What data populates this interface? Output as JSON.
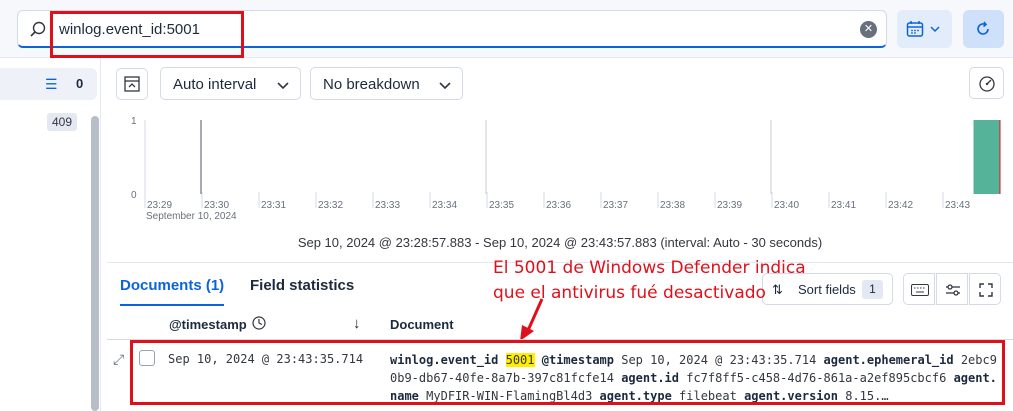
{
  "query": {
    "text": "winlog.event_id:5001"
  },
  "sidebar": {
    "filter_count": "0",
    "field_count": "409"
  },
  "chart_toolbar": {
    "interval_label": "Auto interval",
    "breakdown_label": "No breakdown"
  },
  "chart_data": {
    "type": "bar",
    "y_ticks": [
      "1",
      "0"
    ],
    "x_tick_labels": [
      "23:29",
      "23:30",
      "23:31",
      "23:32",
      "23:33",
      "23:34",
      "23:35",
      "23:36",
      "23:37",
      "23:38",
      "23:39",
      "23:40",
      "23:41",
      "23:42",
      "23:43"
    ],
    "x_sublabel": "September 10, 2024",
    "values": [
      0,
      0,
      0,
      0,
      0,
      0,
      0,
      0,
      0,
      0,
      0,
      0,
      0,
      0,
      0,
      0,
      0,
      0,
      0,
      0,
      0,
      0,
      0,
      0,
      0,
      0,
      0,
      0,
      0,
      1
    ],
    "ylim": [
      0,
      1
    ],
    "bar_color": "#54b399",
    "time_range": "Sep 10, 2024 @ 23:28:57.883 - Sep 10, 2024 @ 23:43:57.883 (interval: Auto - 30 seconds)"
  },
  "tabs": {
    "documents": "Documents (1)",
    "field_statistics": "Field statistics"
  },
  "sort": {
    "label": "Sort fields",
    "count": "1"
  },
  "annotation": {
    "line1": "El 5001 de Windows Defender indica",
    "line2": "que el antivirus fué desactivado"
  },
  "grid": {
    "col_timestamp": "@timestamp",
    "col_document": "Document",
    "row": {
      "timestamp": "Sep 10, 2024 @ 23:43:35.714",
      "k1": "winlog.event_id",
      "v1": "5001",
      "k2": "@timestamp",
      "v2": "Sep 10, 2024 @ 23:43:35.714",
      "k3": "agent.ephemeral_id",
      "v3": "2ebc90b9-db67-40fe-8a7b-397c81fcfe14",
      "k4": "agent.id",
      "v4": "fc7f8ff5-c458-4d76-861a-a2ef895cbcf6",
      "k5": "agent.name",
      "v5": "MyDFIR-WIN-FlamingBl4d3",
      "k6": "agent.type",
      "v6": "filebeat",
      "k7": "agent.version",
      "v7": "8.15.…"
    }
  },
  "colors": {
    "accent": "#0b64dd",
    "annotation": "#e0101a",
    "highlight": "#ffee00"
  }
}
